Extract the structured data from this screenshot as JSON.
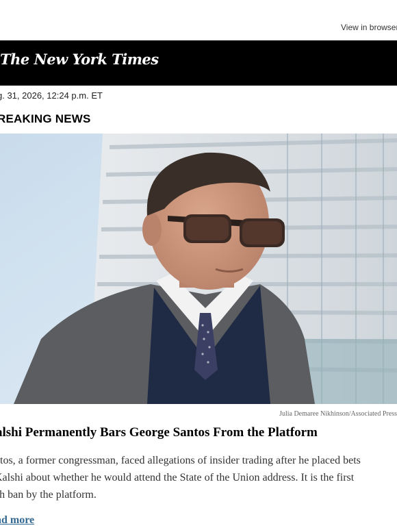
{
  "header": {
    "view_in_browser": "View in browser"
  },
  "masthead": {
    "logo_text": "The New York Times"
  },
  "article": {
    "dateline": "g. 31, 2026, 12:24 p.m. ET",
    "kicker": "REAKING NEWS",
    "photo_credit": "Julia Demaree Nikhinson/Associated Press",
    "headline": "alshi Permanently Bars George Santos From the Platform",
    "summary_lines": [
      "ntos, a former congressman, faced allegations of insider trading after he placed bets",
      " Kalshi about whether he would attend the State of the Union address. It is the first",
      "ch ban by the platform."
    ],
    "read_more": "ad more"
  },
  "colors": {
    "masthead_bg": "#000000",
    "link": "#326891"
  }
}
